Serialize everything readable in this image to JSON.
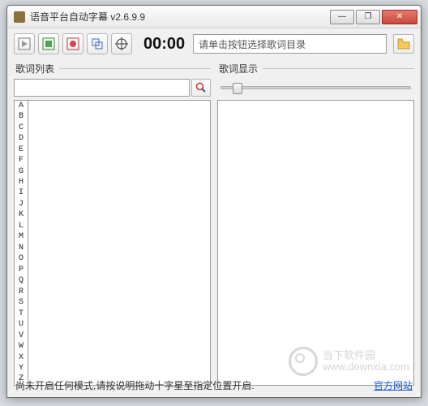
{
  "window": {
    "title": "语音平台自动字幕 v2.6.9.9"
  },
  "winctrl": {
    "min": "—",
    "max": "❐",
    "close": "✕"
  },
  "toolbar": {
    "time": "00:00",
    "dir_placeholder": "请单击按钮选择歌词目录"
  },
  "left": {
    "label": "歌词列表",
    "alphabet": [
      "A",
      "B",
      "C",
      "D",
      "E",
      "F",
      "G",
      "H",
      "I",
      "J",
      "K",
      "L",
      "M",
      "N",
      "O",
      "P",
      "Q",
      "R",
      "S",
      "T",
      "U",
      "V",
      "W",
      "X",
      "Y",
      "Z"
    ]
  },
  "right": {
    "label": "歌词显示"
  },
  "footer": {
    "status": "尚未开启任何模式,请按说明拖动十字星至指定位置开启.",
    "link": "官方网站"
  },
  "watermark": {
    "line1": "当下软件园",
    "line2": "www.downxia.com"
  }
}
